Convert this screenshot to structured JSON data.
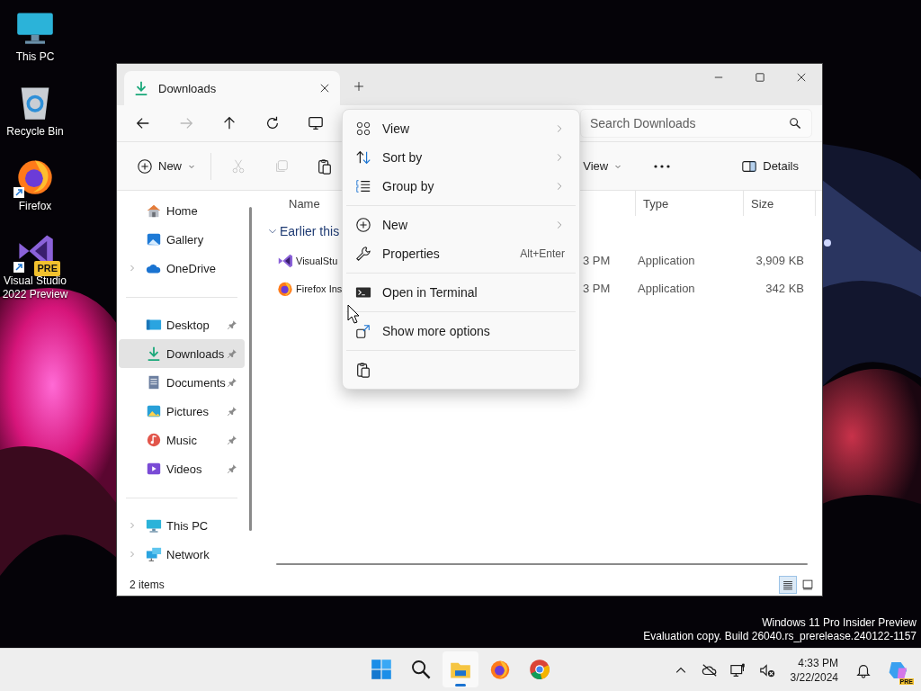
{
  "desktop": {
    "icons": [
      {
        "label": "This PC",
        "kind": "pc",
        "shortcut": false
      },
      {
        "label": "Recycle Bin",
        "kind": "bin",
        "shortcut": false
      },
      {
        "label": "Firefox",
        "kind": "firefox",
        "shortcut": true
      },
      {
        "label": "Visual Studio 2022 Preview",
        "kind": "vs",
        "shortcut": true,
        "badge": "PRE"
      }
    ],
    "watermark": [
      "Windows 11 Pro Insider Preview",
      "Evaluation copy. Build 26040.rs_prerelease.240122-1157"
    ]
  },
  "explorer": {
    "tab": {
      "title": "Downloads"
    },
    "nav_buttons": [
      {
        "kind": "back",
        "disabled": false
      },
      {
        "kind": "forward",
        "disabled": true
      },
      {
        "kind": "up",
        "disabled": false
      },
      {
        "kind": "refresh",
        "disabled": false
      },
      {
        "kind": "pc",
        "disabled": false
      }
    ],
    "search": {
      "placeholder": "Search Downloads"
    },
    "command_bar": {
      "new_label": "New",
      "tools": [
        {
          "kind": "cut",
          "disabled": true
        },
        {
          "kind": "copy",
          "disabled": true
        },
        {
          "kind": "paste",
          "disabled": false
        }
      ],
      "view_label": "View",
      "details_label": "Details"
    },
    "sidebar": {
      "groups": [
        {
          "items": [
            {
              "label": "Home",
              "kind": "home",
              "expandable": false,
              "pinned": false,
              "selected": false
            },
            {
              "label": "Gallery",
              "kind": "gallery",
              "expandable": false,
              "pinned": false,
              "selected": false
            },
            {
              "label": "OneDrive",
              "kind": "cloud",
              "expandable": true,
              "pinned": false,
              "selected": false
            }
          ]
        },
        {
          "items": [
            {
              "label": "Desktop",
              "kind": "desktop",
              "expandable": false,
              "pinned": true,
              "selected": false
            },
            {
              "label": "Downloads",
              "kind": "download",
              "expandable": false,
              "pinned": true,
              "selected": true
            },
            {
              "label": "Documents",
              "kind": "document",
              "expandable": false,
              "pinned": true,
              "selected": false
            },
            {
              "label": "Pictures",
              "kind": "pictures",
              "expandable": false,
              "pinned": true,
              "selected": false
            },
            {
              "label": "Music",
              "kind": "music",
              "expandable": false,
              "pinned": true,
              "selected": false
            },
            {
              "label": "Videos",
              "kind": "videos",
              "expandable": false,
              "pinned": true,
              "selected": false
            }
          ]
        },
        {
          "items": [
            {
              "label": "This PC",
              "kind": "pc",
              "expandable": true,
              "pinned": false,
              "selected": false
            },
            {
              "label": "Network",
              "kind": "network",
              "expandable": true,
              "pinned": false,
              "selected": false
            }
          ]
        }
      ]
    },
    "columns": [
      "Name",
      "Type",
      "Size"
    ],
    "group": {
      "label": "Earlier this",
      "expanded": true,
      "rows": [
        {
          "name": "VisualStu",
          "kind": "vs",
          "date": "3 PM",
          "type": "Application",
          "size": "3,909 KB"
        },
        {
          "name": "Firefox Ins",
          "kind": "firefox",
          "date": "3 PM",
          "type": "Application",
          "size": "342 KB"
        }
      ]
    },
    "status": "2 items",
    "view_modes": [
      {
        "kind": "details",
        "selected": true
      },
      {
        "kind": "tiles",
        "selected": false
      }
    ]
  },
  "context_menu": {
    "sections": [
      {
        "items": [
          {
            "kind": "view",
            "label": "View",
            "submenu": true
          },
          {
            "kind": "sort",
            "label": "Sort by",
            "submenu": true
          },
          {
            "kind": "group",
            "label": "Group by",
            "submenu": true
          }
        ]
      },
      {
        "items": [
          {
            "kind": "new",
            "label": "New",
            "submenu": true
          },
          {
            "kind": "properties",
            "label": "Properties",
            "submenu": false,
            "shortcut": "Alt+Enter"
          }
        ]
      },
      {
        "items": [
          {
            "kind": "terminal",
            "label": "Open in Terminal",
            "submenu": false
          }
        ]
      },
      {
        "items": [
          {
            "kind": "more",
            "label": "Show more options",
            "submenu": false
          }
        ]
      },
      {
        "items": [
          {
            "kind": "paste",
            "submenu": false
          }
        ]
      }
    ]
  },
  "taskbar": {
    "apps": [
      {
        "kind": "start",
        "selected": false
      },
      {
        "kind": "search",
        "selected": false
      },
      {
        "kind": "explorer",
        "selected": true
      },
      {
        "kind": "firefox",
        "selected": false
      },
      {
        "kind": "chrome",
        "selected": false
      }
    ],
    "time": "4:33 PM",
    "date": "3/22/2024",
    "copilot_badge": "PRE"
  }
}
